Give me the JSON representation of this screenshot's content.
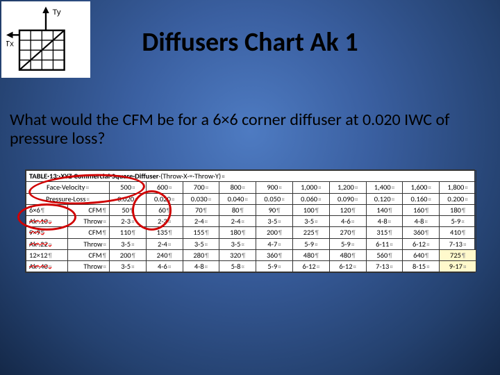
{
  "title": "Diffusers Chart Ak 1",
  "question": "What would the CFM be for a 6×6 corner diffuser at 0.020 IWC of pressure loss?",
  "diagram": {
    "tx_label": "Tx",
    "ty_label": "Ty"
  },
  "table": {
    "title_prefix": "TABLE·13:·XYZ·Commercial·Square·Diffuser",
    "title_suffix": "·(Throw·X·=·Throw·Y)",
    "header": {
      "face_velocity_label": "Face·Velocity",
      "pressure_loss_label": "Pressure·Loss",
      "velocities": [
        "500",
        "600",
        "700",
        "800",
        "900",
        "1,000",
        "1,200",
        "1,400",
        "1,600",
        "1,800"
      ],
      "pressure": [
        "0.020",
        "0.020",
        "0.030",
        "0.040",
        "0.050",
        "0.060",
        "0.090",
        "0.120",
        "0.160",
        "0.200"
      ]
    },
    "groups": [
      {
        "size": "6×6",
        "ak": "Ak·.10",
        "cfm": [
          "50",
          "60",
          "70",
          "80",
          "90",
          "100",
          "120",
          "140",
          "160",
          "180"
        ],
        "throw": [
          "2-3",
          "2-3",
          "2-4",
          "2-4",
          "3-5",
          "3-5",
          "4-6",
          "4-8",
          "4-8",
          "5-9"
        ]
      },
      {
        "size": "9×9",
        "ak": "Ak·.22",
        "cfm": [
          "110",
          "135",
          "155",
          "180",
          "200",
          "225",
          "270",
          "315",
          "360",
          "410"
        ],
        "throw": [
          "3-5",
          "2-4",
          "3-5",
          "3-5",
          "4-7",
          "5-9",
          "5-9",
          "6-11",
          "6-12",
          "7-13"
        ]
      },
      {
        "size": "12×12",
        "ak": "Ak·.40",
        "cfm": [
          "200",
          "240",
          "280",
          "320",
          "360",
          "480",
          "480",
          "560",
          "640",
          "725"
        ],
        "throw": [
          "3-5",
          "4-6",
          "4-8",
          "5-8",
          "5-9",
          "6-12",
          "6-12",
          "7-13",
          "8-15",
          "9-17"
        ]
      }
    ],
    "cfm_label": "CFM",
    "throw_label": "Throw"
  }
}
